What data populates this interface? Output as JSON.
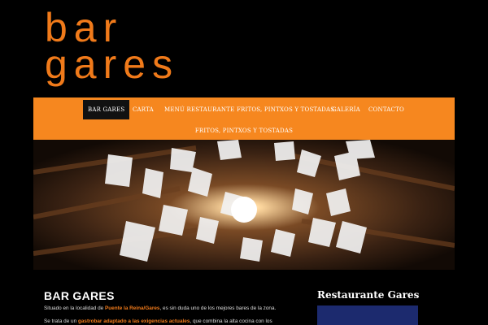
{
  "logo": {
    "line1": "bar",
    "line2": "gares"
  },
  "nav": {
    "items": [
      {
        "label": "BAR GARES",
        "active": true
      },
      {
        "label": "CARTA"
      },
      {
        "label": "MENÚ RESTAURANTE"
      },
      {
        "label": "FRITOS, PINTXOS Y TOSTADAS"
      },
      {
        "label": "GALERÍA"
      },
      {
        "label": "CONTACTO"
      }
    ],
    "row2_label": "FRITOS, PINTXOS Y TOSTADAS"
  },
  "hero": {
    "icon": "paper-lamp-photo"
  },
  "content": {
    "title": "BAR GARES",
    "p1_pre": "Situado en la localidad de ",
    "p1_link": "Puente la Reina/Gares",
    "p1_post": ", es sin duda uno de los mejores bares de la zona.",
    "p2_pre": "Se trata de un ",
    "p2_link": "gastrobar adaptado a las exigencias actuales",
    "p2_post": ", que combina la alta cocina con los"
  },
  "sidebar": {
    "title": "Restaurante Gares"
  },
  "colors": {
    "accent": "#f6871f",
    "logo": "#f07a1a",
    "background": "#000000"
  }
}
